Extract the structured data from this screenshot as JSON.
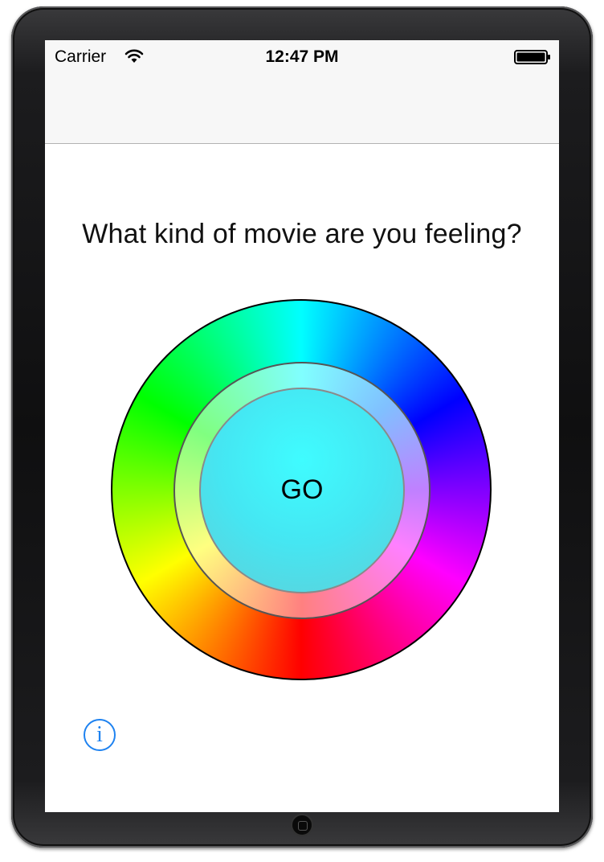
{
  "status_bar": {
    "carrier": "Carrier",
    "time": "12:47 PM",
    "wifi_icon": "wifi-icon",
    "battery_icon": "battery-icon",
    "battery_level": 1.0
  },
  "main": {
    "question": "What kind of movie are you feeling?",
    "go_label": "GO",
    "info_icon": "info-icon",
    "info_glyph": "i"
  },
  "colors": {
    "accent": "#1e82f0",
    "go_fill": "#45e6f2"
  }
}
